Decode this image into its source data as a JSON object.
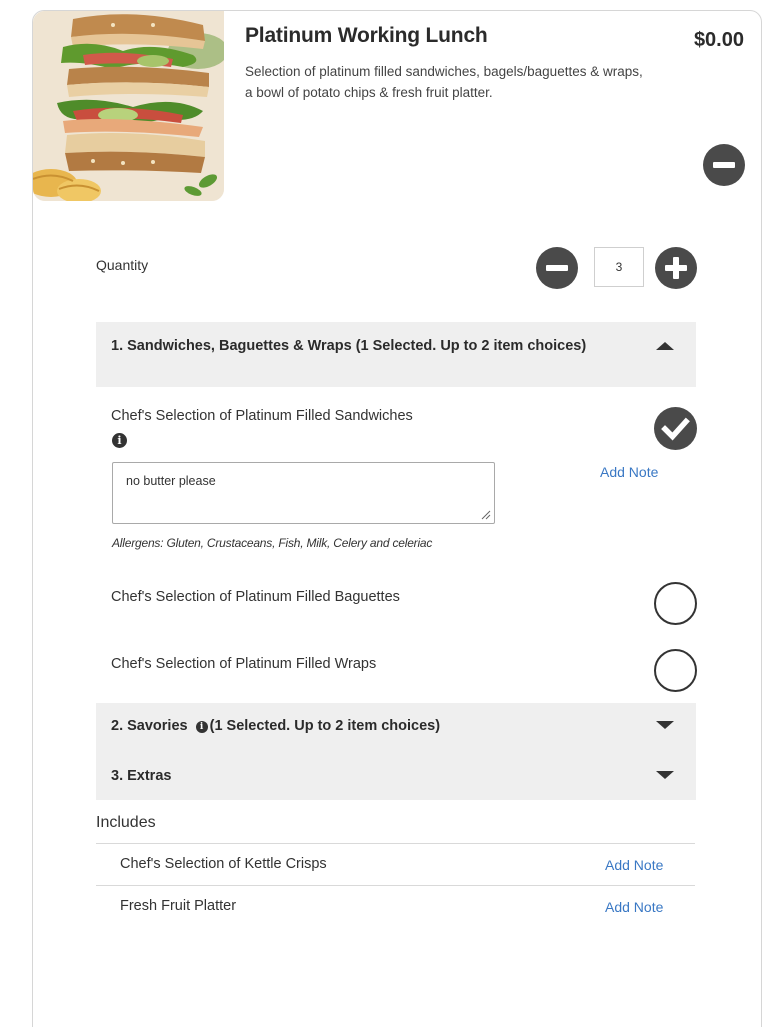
{
  "product": {
    "title": "Platinum Working Lunch",
    "price": "$0.00",
    "description": "Selection of platinum filled sandwiches, bagels/baguettes & wraps, a bowl of potato chips & fresh fruit platter."
  },
  "quantity": {
    "label": "Quantity",
    "value": "3"
  },
  "sections": [
    {
      "title": "1. Sandwiches, Baguettes & Wraps (1 Selected. Up to 2 item choices)",
      "expanded": true,
      "options": [
        {
          "label": "Chef's Selection of Platinum Filled Sandwiches",
          "selected": true,
          "note": "no butter please",
          "add_note": "Add Note",
          "allergens": "Allergens: Gluten, Crustaceans, Fish, Milk, Celery and celeriac"
        },
        {
          "label": "Chef's Selection of Platinum Filled Baguettes",
          "selected": false
        },
        {
          "label": "Chef's Selection of Platinum Filled Wraps",
          "selected": false
        }
      ]
    },
    {
      "title_prefix": "2. Savories",
      "title_suffix": "(1 Selected. Up to 2 item choices)",
      "expanded": false
    },
    {
      "title": "3. Extras",
      "expanded": false
    }
  ],
  "includes": {
    "title": "Includes",
    "items": [
      {
        "label": "Chef's Selection of Kettle Crisps",
        "add_note": "Add Note"
      },
      {
        "label": "Fresh Fruit Platter",
        "add_note": "Add Note"
      }
    ]
  },
  "colors": {
    "dark_button": "#4a4a4a",
    "section_bg": "#efefef",
    "link": "#3a78c4"
  }
}
